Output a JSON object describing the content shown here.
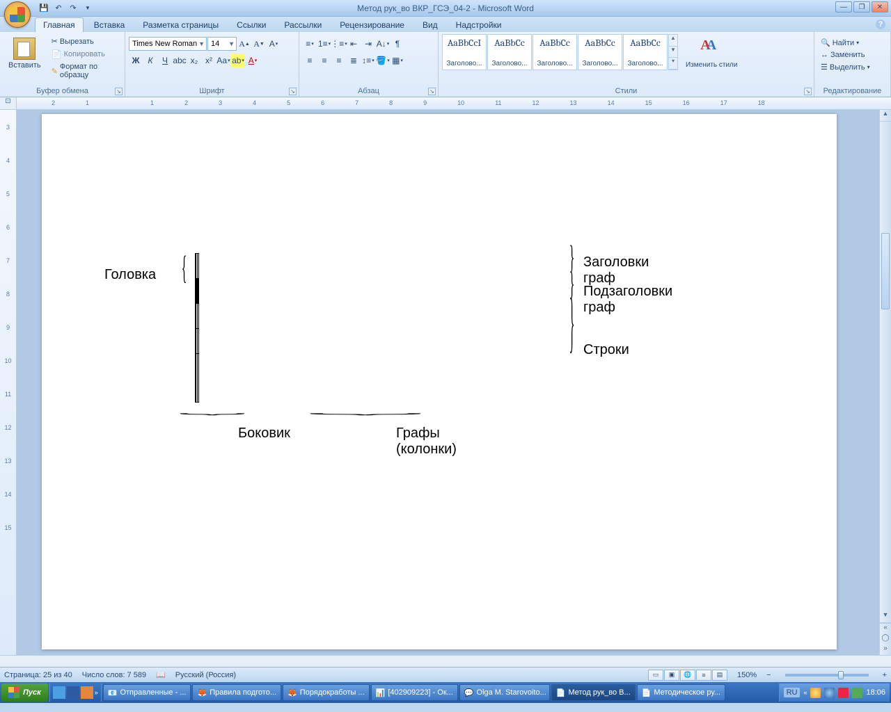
{
  "title": "Метод рук_во ВКР_ГСЭ_04-2 - Microsoft Word",
  "tabs": [
    "Главная",
    "Вставка",
    "Разметка страницы",
    "Ссылки",
    "Рассылки",
    "Рецензирование",
    "Вид",
    "Надстройки"
  ],
  "clipboard": {
    "label": "Буфер обмена",
    "paste": "Вставить",
    "cut": "Вырезать",
    "copy": "Копировать",
    "format": "Формат по образцу"
  },
  "font": {
    "label": "Шрифт",
    "name": "Times New Roman",
    "size": "14"
  },
  "paragraph": {
    "label": "Абзац"
  },
  "styles": {
    "label": "Стили",
    "change": "Изменить стили",
    "items": [
      {
        "preview": "AaBbCcI",
        "name": "Заголово..."
      },
      {
        "preview": "AaBbCc",
        "name": "Заголово..."
      },
      {
        "preview": "AaBbCc",
        "name": "Заголово..."
      },
      {
        "preview": "AaBbCc",
        "name": "Заголово..."
      },
      {
        "preview": "AaBbCc",
        "name": "Заголово..."
      }
    ]
  },
  "editing": {
    "label": "Редактирование",
    "find": "Найти",
    "replace": "Заменить",
    "select": "Выделить"
  },
  "document": {
    "labels": {
      "head": "Головка",
      "colheaders": "Заголовки граф",
      "subheaders": "Подзаголовки граф",
      "rows": "Строки",
      "side": "Боковик",
      "columns": "Графы (колонки)"
    }
  },
  "status": {
    "page": "Страница: 25 из 40",
    "words": "Число слов: 7 589",
    "lang": "Русский (Россия)",
    "zoom": "150%"
  },
  "taskbar": {
    "start": "Пуск",
    "apps": [
      "Отправленные - ...",
      "Правила подгото...",
      "Порядокработы ...",
      "[402909223] - Ок...",
      "Olga M. Starovoito...",
      "Метод рук_во В...",
      "Методическое ру..."
    ],
    "lang": "RU",
    "time": "18:06"
  }
}
